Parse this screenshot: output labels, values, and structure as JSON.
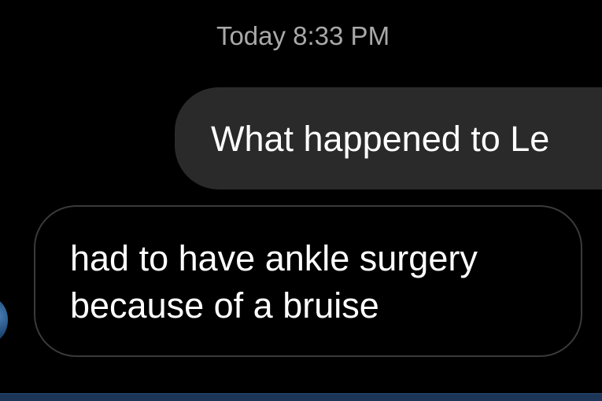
{
  "conversation": {
    "timestamp": "Today 8:33 PM",
    "messages": [
      {
        "direction": "outgoing",
        "text": "What happened to Le"
      },
      {
        "direction": "incoming",
        "lines": [
          "had to have ankle surgery",
          "because of a bruise"
        ]
      }
    ]
  },
  "colors": {
    "background": "#000000",
    "outgoing_bubble": "#2a2a2a",
    "incoming_bubble_border": "#3a3a3a",
    "timestamp_text": "#a9a9a9",
    "message_text": "#ffffff",
    "bottom_bar": "#1d3557"
  },
  "icons": {
    "sender_avatar": "avatar-icon"
  }
}
